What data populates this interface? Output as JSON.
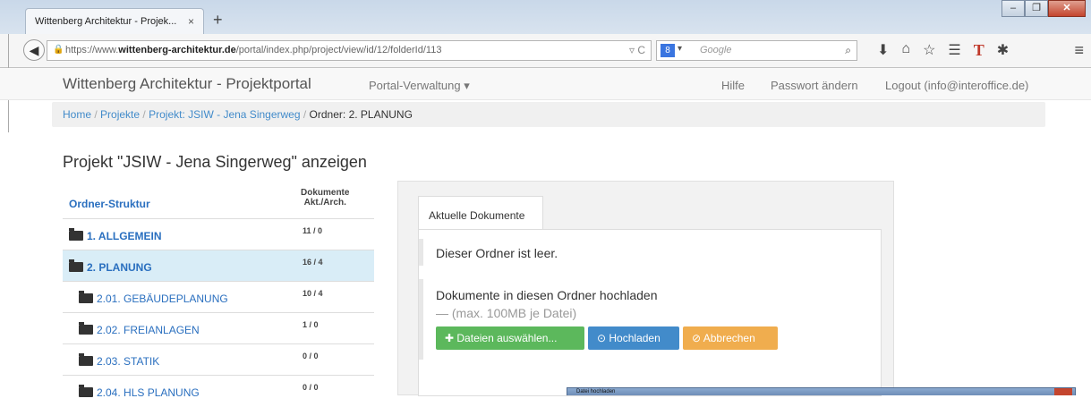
{
  "browser": {
    "tab_title": "Wittenberg Architektur - Projek...",
    "tab_close": "×",
    "new_tab": "+",
    "url_prefix": "https://www.",
    "url_domain": "wittenberg-architektur.de",
    "url_path": "/portal/index.php/project/view/id/12/folderId/113",
    "search_placeholder": "Google"
  },
  "portal_nav": {
    "brand": "Wittenberg Architektur - Projektportal",
    "admin": "Portal-Verwaltung ▾",
    "help": "Hilfe",
    "password": "Passwort ändern",
    "logout": "Logout (info@interoffice.de)"
  },
  "breadcrumb": {
    "home": "Home",
    "projects": "Projekte",
    "project": "Projekt: JSIW - Jena Singerweg",
    "current": "Ordner: 2. PLANUNG",
    "sep": "/"
  },
  "page_title": "Projekt \"JSIW - Jena Singerweg\" anzeigen",
  "tree": {
    "header_label": "Ordner-Struktur",
    "header_docs": "Dokumente",
    "header_docs_sub": "Akt./Arch.",
    "rows": [
      {
        "label": "1. ALLGEMEIN",
        "count": "11 / 0"
      },
      {
        "label": "2. PLANUNG",
        "count": "16 / 4"
      },
      {
        "label": "2.01. GEBÄUDEPLANUNG",
        "count": "10 / 4"
      },
      {
        "label": "2.02. FREIANLAGEN",
        "count": "1 / 0"
      },
      {
        "label": "2.03. STATIK",
        "count": "0 / 0"
      },
      {
        "label": "2.04. HLS PLANUNG",
        "count": "0 / 0"
      }
    ]
  },
  "docs": {
    "tab": "Aktuelle Dokumente",
    "empty": "Dieser Ordner ist leer.",
    "upload_title": "Dokumente in diesen Ordner hochladen",
    "upload_limit": "— (max. 100MB je Datei)",
    "btn_select": "Dateien auswählen...",
    "btn_upload": "Hochladen",
    "btn_cancel": "Abbrechen"
  },
  "dialog": {
    "title": "Datei hochladen"
  }
}
